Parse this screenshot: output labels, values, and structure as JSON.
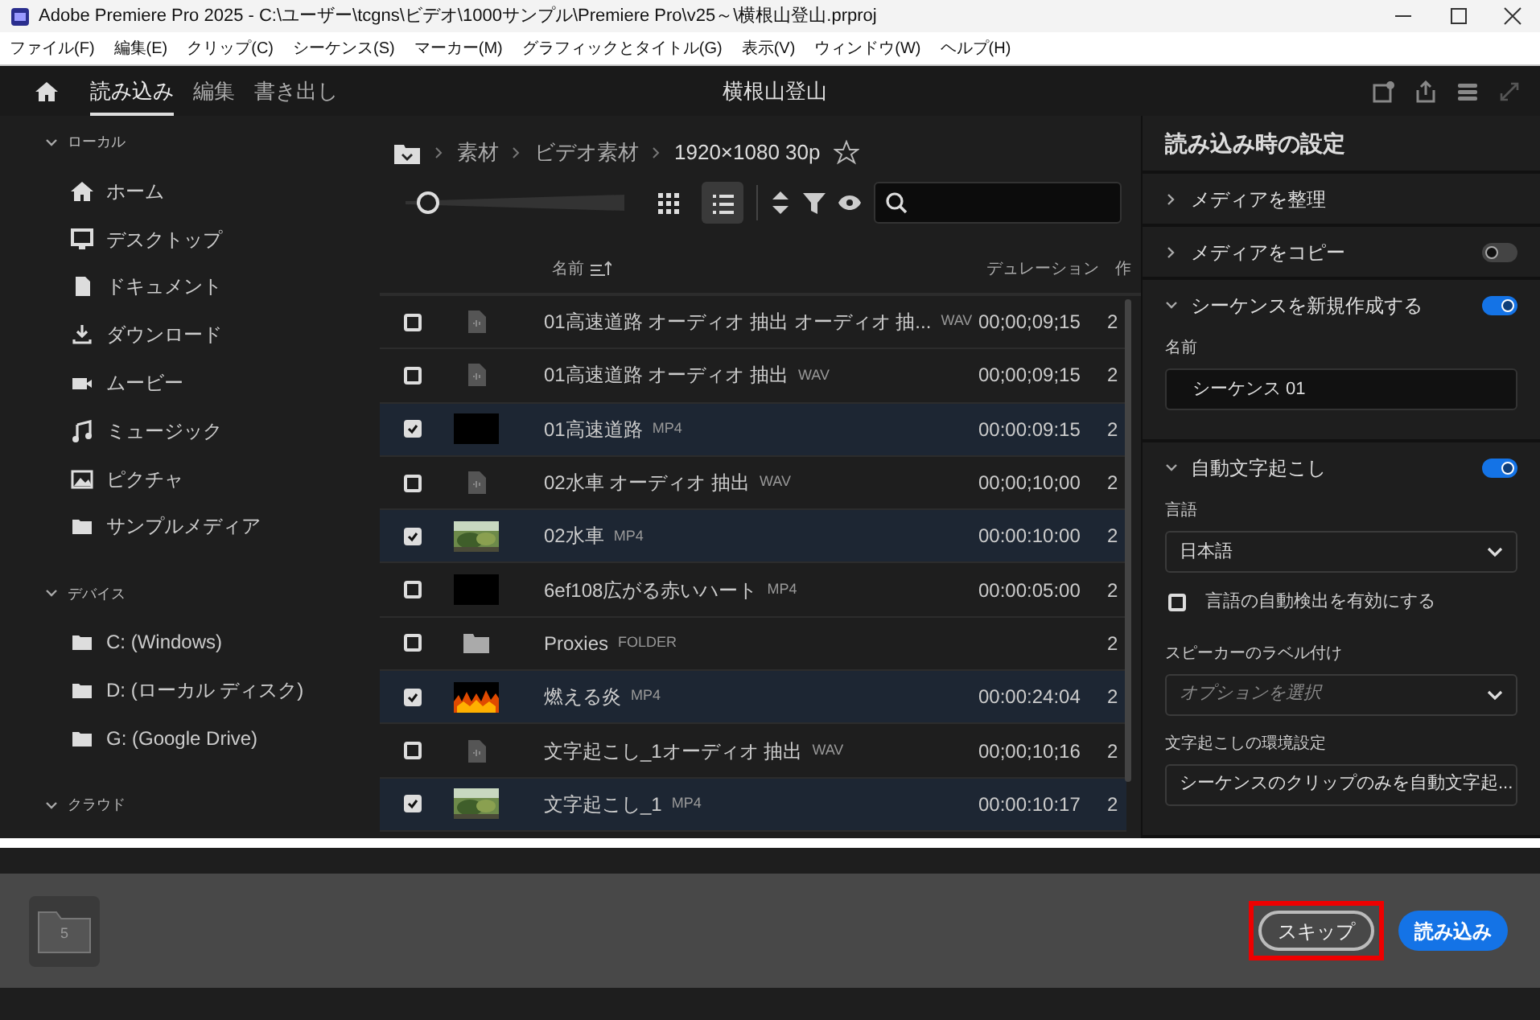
{
  "window": {
    "title": "Adobe Premiere Pro 2025 - C:\\ユーザー\\tcgns\\ビデオ\\1000サンプル\\Premiere Pro\\v25～\\横根山登山.prproj"
  },
  "menu": [
    "ファイル(F)",
    "編集(E)",
    "クリップ(C)",
    "シーケンス(S)",
    "マーカー(M)",
    "グラフィックとタイトル(G)",
    "表示(V)",
    "ウィンドウ(W)",
    "ヘルプ(H)"
  ],
  "app_tabs": [
    {
      "label": "読み込み",
      "selected": true
    },
    {
      "label": "編集",
      "selected": false
    },
    {
      "label": "書き出し",
      "selected": false
    }
  ],
  "project_title": "横根山登山",
  "sidebar": {
    "groups": [
      {
        "label": "ローカル",
        "expanded": true,
        "items": [
          {
            "label": "ホーム",
            "kind": "home"
          },
          {
            "label": "デスクトップ",
            "kind": "desktop"
          },
          {
            "label": "ドキュメント",
            "kind": "document"
          },
          {
            "label": "ダウンロード",
            "kind": "download"
          },
          {
            "label": "ムービー",
            "kind": "movie"
          },
          {
            "label": "ミュージック",
            "kind": "music"
          },
          {
            "label": "ピクチャ",
            "kind": "picture"
          },
          {
            "label": "サンプルメディア",
            "kind": "folder"
          }
        ]
      },
      {
        "label": "デバイス",
        "expanded": true,
        "items": [
          {
            "label": "C: (Windows)",
            "kind": "folder"
          },
          {
            "label": "D: (ローカル ディスク)",
            "kind": "folder"
          },
          {
            "label": "G: (Google Drive)",
            "kind": "folder"
          }
        ]
      },
      {
        "label": "クラウド",
        "expanded": true
      }
    ]
  },
  "breadcrumb": [
    "素材",
    "ビデオ素材",
    "1920×1080 30p"
  ],
  "toolbar": {
    "thumb_size": {
      "level": 0.05
    },
    "view_modes": [
      {
        "kind": "grid",
        "selected": false
      },
      {
        "kind": "list",
        "selected": true
      }
    ]
  },
  "table": {
    "columns": [
      "名前",
      "デュレーション",
      "作"
    ],
    "rows": [
      {
        "checked": false,
        "kind": "audio",
        "name": "01高速道路 オーディオ 抽出 オーディオ 抽...",
        "type": "WAV",
        "duration": "00;00;09;15",
        "column_3": "2"
      },
      {
        "checked": false,
        "kind": "audio",
        "name": "01高速道路 オーディオ 抽出",
        "type": "WAV",
        "duration": "00;00;09;15",
        "column_3": "2"
      },
      {
        "checked": true,
        "kind": "black",
        "name": "01高速道路",
        "type": "MP4",
        "duration": "00:00:09:15",
        "column_3": "2"
      },
      {
        "checked": false,
        "kind": "audio",
        "name": "02水車 オーディオ 抽出",
        "type": "WAV",
        "duration": "00;00;10;00",
        "column_3": "2"
      },
      {
        "checked": true,
        "kind": "picture",
        "name": "02水車",
        "type": "MP4",
        "duration": "00:00:10:00",
        "column_3": "2"
      },
      {
        "checked": false,
        "kind": "black",
        "name": "6ef108広がる赤いハート",
        "type": "MP4",
        "duration": "00:00:05:00",
        "column_3": "2"
      },
      {
        "checked": false,
        "kind": "folder",
        "name": "Proxies",
        "type": "FOLDER",
        "column_3": "2"
      },
      {
        "checked": true,
        "kind": "fire",
        "name": "燃える炎",
        "type": "MP4",
        "duration": "00:00:24:04",
        "column_3": "2"
      },
      {
        "checked": false,
        "kind": "audio",
        "name": "文字起こし_1オーディオ 抽出",
        "type": "WAV",
        "duration": "00;00;10;16",
        "column_3": "2"
      },
      {
        "checked": true,
        "kind": "picture",
        "name": "文字起こし_1",
        "type": "MP4",
        "duration": "00:00:10:17",
        "column_3": "2"
      }
    ]
  },
  "settings": {
    "title": "読み込み時の設定",
    "sections": [
      {
        "label": "メディアを整理",
        "expanded": false
      },
      {
        "label": "メディアをコピー",
        "expanded": false,
        "toggle_on": false
      },
      {
        "label": "シーケンスを新規作成する",
        "expanded": true,
        "toggle_on": true,
        "fields": [
          {
            "kind": "text",
            "label": "名前",
            "value": "シーケンス 01"
          }
        ]
      },
      {
        "label": "自動文字起こし",
        "expanded": true,
        "toggle_on": true,
        "fields": [
          {
            "kind": "select",
            "label": "言語",
            "value": "日本語"
          },
          {
            "kind": "checkbox",
            "label": "言語の自動検出を有効にする",
            "checked": false
          },
          {
            "kind": "select",
            "label": "スピーカーのラベル付け",
            "placeholder": "オプションを選択"
          },
          {
            "kind": "select",
            "label": "文字起こしの環境設定",
            "value": "シーケンスのクリップのみを自動文字起..."
          }
        ]
      }
    ]
  },
  "import_bar": {
    "count": "5",
    "buttons": [
      {
        "label": "スキップ",
        "kind": "outline",
        "highlighted": true
      },
      {
        "label": "読み込み",
        "kind": "primary",
        "highlighted": false
      }
    ]
  }
}
